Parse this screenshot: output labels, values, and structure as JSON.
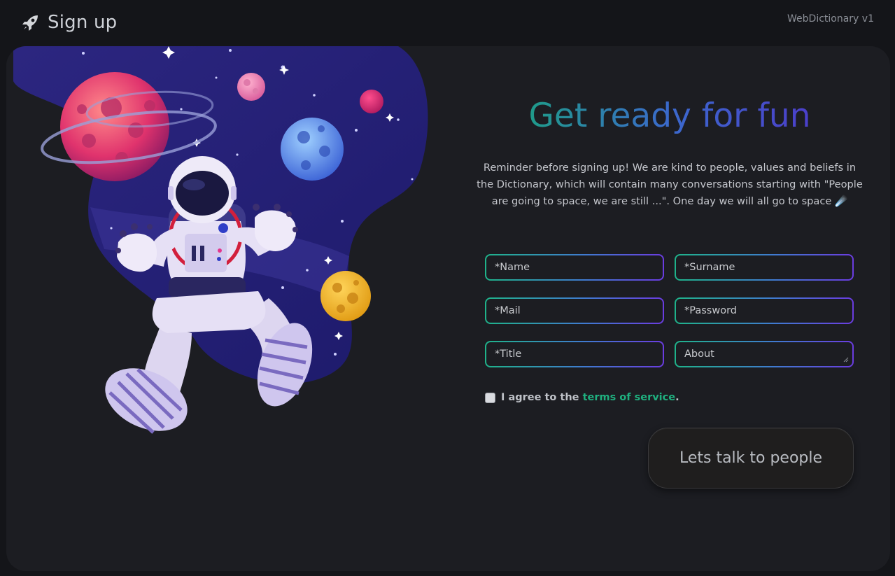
{
  "header": {
    "title": "Sign up",
    "version": "WebDictionary v1",
    "icon": "rocket-icon"
  },
  "main": {
    "heading": "Get ready for fun",
    "reminder": "Reminder before signing up! We are kind to people, values and beliefs in the Dictionary, which will contain many conversations starting with \"People are going to space, we are still ...\". One day we will all go to space ☄️",
    "form": {
      "name_placeholder": "*Name",
      "surname_placeholder": "*Surname",
      "mail_placeholder": "*Mail",
      "password_placeholder": "*Password",
      "title_placeholder": "*Title",
      "about_placeholder": "About"
    },
    "agree": {
      "prefix": "I agree to the",
      "link": "terms of service",
      "suffix": ".",
      "checked": false
    },
    "submit_label": "Lets talk to people"
  },
  "colors": {
    "background": "#141519",
    "panel": "#1c1d22",
    "accent_green": "#1fb07f",
    "accent_purple": "#4b3fca"
  }
}
